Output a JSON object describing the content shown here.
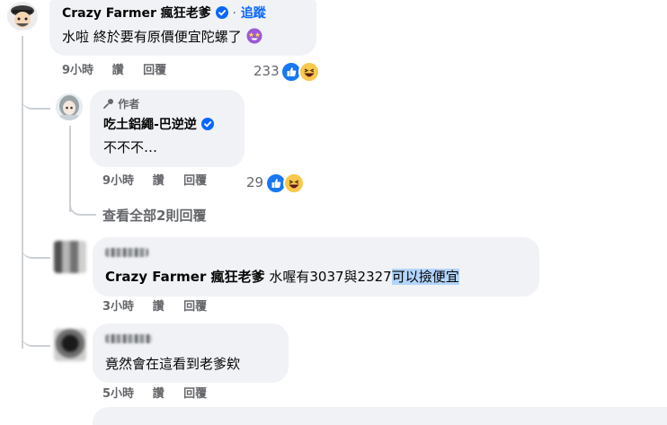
{
  "comments": [
    {
      "author": "Crazy Farmer 瘋狂老爹",
      "follow_separator": "·",
      "follow_label": "追蹤",
      "text": "水啦 終於要有原價便宜陀螺了",
      "time": "9小時",
      "like_label": "讚",
      "reply_label": "回覆",
      "reaction_count": "233",
      "reactions": [
        "like-icon",
        "haha-icon"
      ],
      "emoji": "star-struck-emoji"
    },
    {
      "author_badge": "作者",
      "author": "吃土鋁繩-巴逆逆",
      "text": "不不不…",
      "time": "9小時",
      "like_label": "讚",
      "reply_label": "回覆",
      "reaction_count": "29",
      "reactions": [
        "like-icon",
        "haha-icon"
      ]
    },
    {
      "tagged_name": "Crazy Farmer 瘋狂老爹",
      "text_plain": "水喔有3037與2327",
      "text_selected": "可以撿便宜",
      "time": "3小時",
      "like_label": "讚",
      "reply_label": "回覆"
    },
    {
      "text": "竟然會在這看到老爹欸",
      "time": "5小時",
      "like_label": "讚",
      "reply_label": "回覆"
    }
  ],
  "view_replies_label": "查看全部2則回覆",
  "colors": {
    "bubble": "#f0f2f5",
    "verified": "#0866ff",
    "link": "#0866ff",
    "meta": "#65676b",
    "selection": "#b3d4fc"
  }
}
